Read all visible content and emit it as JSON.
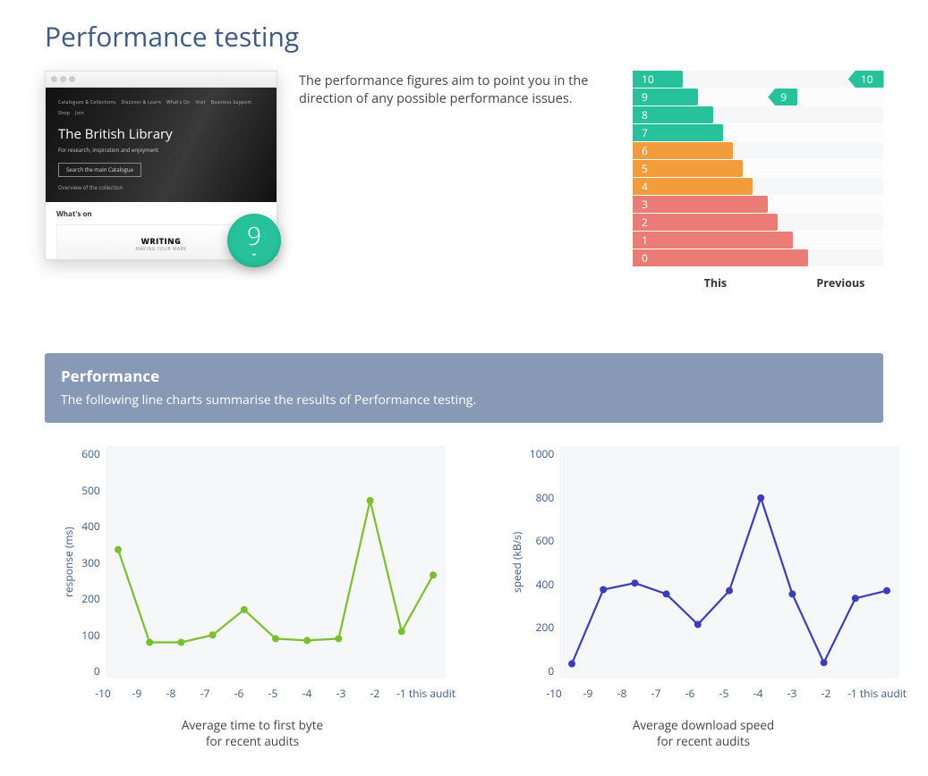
{
  "page_title": "Performance testing",
  "intro_text": "The performance figures aim to point you in the direction of any possible performance issues.",
  "thumbnail": {
    "nav_items": [
      "Catalogues & Collections",
      "Discover & Learn",
      "What's On",
      "Visit",
      "Business Support",
      "Shop",
      "Join"
    ],
    "hero_title": "The British Library",
    "hero_subtitle": "For research, inspiration and enjoyment",
    "hero_button": "Search the main Catalogue",
    "hero_link": "Overview of the collection",
    "whats_on_label": "What's on",
    "banner_title": "WRITING",
    "banner_subtitle": "MAKING YOUR MARK"
  },
  "score": {
    "value": "9"
  },
  "ladder": {
    "levels": [
      "10",
      "9",
      "8",
      "7",
      "6",
      "5",
      "4",
      "3",
      "2",
      "1",
      "0"
    ],
    "widths_pct": [
      20,
      26,
      32,
      36,
      40,
      44,
      48,
      54,
      58,
      64,
      70
    ],
    "colors": [
      "#27c29b",
      "#27c29b",
      "#27c29b",
      "#27c29b",
      "#f39c3c",
      "#f39c3c",
      "#f39c3c",
      "#ea7b76",
      "#ea7b76",
      "#ea7b76",
      "#ea7b76"
    ],
    "this": {
      "level_index": 1,
      "label": "9",
      "color": "#27c29b",
      "left_pct": 54
    },
    "previous": {
      "level_index": 0,
      "label": "10",
      "color": "#27c29b",
      "left_pct": 86
    },
    "legend_this": "This",
    "legend_previous": "Previous"
  },
  "section": {
    "title": "Performance",
    "subtitle": "The following line charts summarise the results of Performance testing."
  },
  "chart_data": [
    {
      "type": "line",
      "title": "",
      "xlabel": "",
      "ylabel": "response (ms)",
      "caption_line1": "Average time to first byte",
      "caption_line2": "for recent audits",
      "color": "#7bbf2e",
      "ylim": [
        0,
        600
      ],
      "yticks": [
        0,
        100,
        200,
        300,
        400,
        500,
        600
      ],
      "categories": [
        "-10",
        "-9",
        "-8",
        "-7",
        "-6",
        "-5",
        "-4",
        "-3",
        "-2",
        "-1 this audit"
      ],
      "values": [
        335,
        80,
        80,
        100,
        170,
        90,
        85,
        90,
        470,
        110,
        265
      ]
    },
    {
      "type": "line",
      "title": "",
      "xlabel": "",
      "ylabel": "speed (kB/s)",
      "caption_line1": "Average download speed",
      "caption_line2": "for recent audits",
      "color": "#3d3db8",
      "ylim": [
        0,
        1000
      ],
      "yticks": [
        0,
        200,
        400,
        600,
        800,
        1000
      ],
      "categories": [
        "-10",
        "-9",
        "-8",
        "-7",
        "-6",
        "-5",
        "-4",
        "-3",
        "-2",
        "-1 this audit"
      ],
      "values": [
        35,
        375,
        405,
        355,
        215,
        370,
        795,
        355,
        40,
        335,
        370
      ]
    }
  ]
}
